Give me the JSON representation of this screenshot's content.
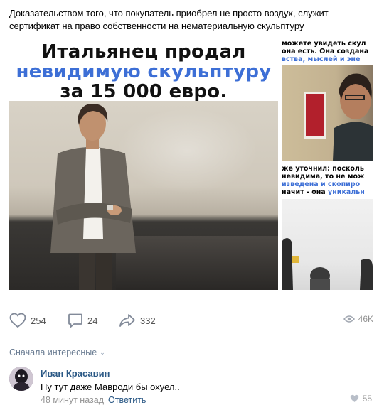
{
  "post": {
    "text": "Доказательством того, что покупатель приобрел не просто воздух, служит сертификат на право собственности на нематериальную скульптуру"
  },
  "gallery": {
    "main": {
      "line1": "Итальянец продал",
      "line2": "невидимую скульптуру",
      "line3": "за 15 000 евро."
    },
    "side_top": {
      "line1": "можете увидеть скул",
      "line2": "она есть. Она создана",
      "line3": "вства, мыслей и эне",
      "line4": "пояснил скульптор."
    },
    "side_bottom": {
      "line1": "же уточнил: посколь",
      "line2": "невидима, то не мож",
      "line3": "изведена и скопиро",
      "line4a": "начит - она ",
      "line4b": "уникальн"
    }
  },
  "actions": {
    "likes": "254",
    "comments": "24",
    "shares": "332",
    "views": "46K"
  },
  "comments_sort": {
    "label": "Сначала интересные"
  },
  "comment": {
    "author": "Иван Красавин",
    "text": "Ну тут даже Мавроди бы охуел..",
    "time": "48 минут назад",
    "reply": "Ответить",
    "likes": "55"
  },
  "colors": {
    "link": "#2a5885",
    "headline_blue": "#3d6fd6",
    "muted": "#939393"
  }
}
